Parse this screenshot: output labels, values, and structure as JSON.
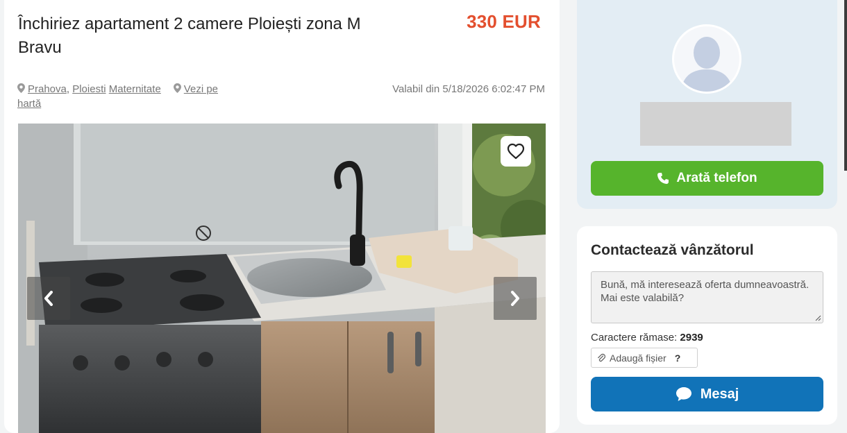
{
  "listing": {
    "title": "Închiriez apartament 2 camere Ploiești zona M Bravu",
    "price": "330 EUR",
    "location": {
      "county": "Prahova",
      "separator": ",",
      "city": "Ploiesti",
      "area": "Maternitate",
      "map_link": "Vezi pe hartă"
    },
    "valid_from": "Valabil din 5/18/2026 6:02:47 PM",
    "gallery": {
      "favorite_icon": "heart-outline-icon",
      "prev_icon": "chevron-left-icon",
      "next_icon": "chevron-right-icon"
    }
  },
  "seller": {
    "avatar_icon": "user-silhouette-icon",
    "phone_button_label": "Arată telefon",
    "phone_icon": "phone-icon"
  },
  "contact": {
    "heading": "Contactează vânzătorul",
    "message_text": "Bună, mă interesează oferta dumneavoastră. Mai este valabilă?",
    "chars_label": "Caractere rămase:",
    "chars_remaining": "2939",
    "attach_label": "Adaugă fișier",
    "attach_help": "?",
    "attach_icon": "paperclip-icon",
    "send_label": "Mesaj",
    "send_icon": "chat-bubble-icon"
  },
  "colors": {
    "price": "#e34f2e",
    "phone_button": "#56b42c",
    "send_button": "#1173b8",
    "seller_card_bg": "#e3edf4"
  }
}
